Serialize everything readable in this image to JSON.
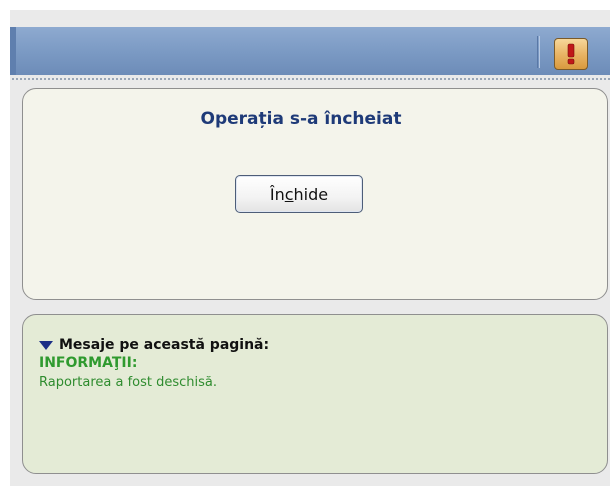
{
  "dialog": {
    "title": "Operația s-a încheiat",
    "close_button": {
      "label_before": "În",
      "label_mnemonic": "c",
      "label_after": "hide"
    }
  },
  "titlebar": {
    "warning_icon": "exclamation-icon",
    "warning_glyph": "!"
  },
  "messages": {
    "header": "Mesaje pe această pagină:",
    "collapse_icon": "triangle-down-icon",
    "info_label": "INFORMAŢII:",
    "info_text": "Raportarea a fost deschisă."
  },
  "colors": {
    "titlebar": "#7a99c3",
    "title_text": "#1e3a78",
    "info_green": "#2f9a2f",
    "warning_fill": "#e9b566",
    "warning_glyph": "#c01818"
  }
}
